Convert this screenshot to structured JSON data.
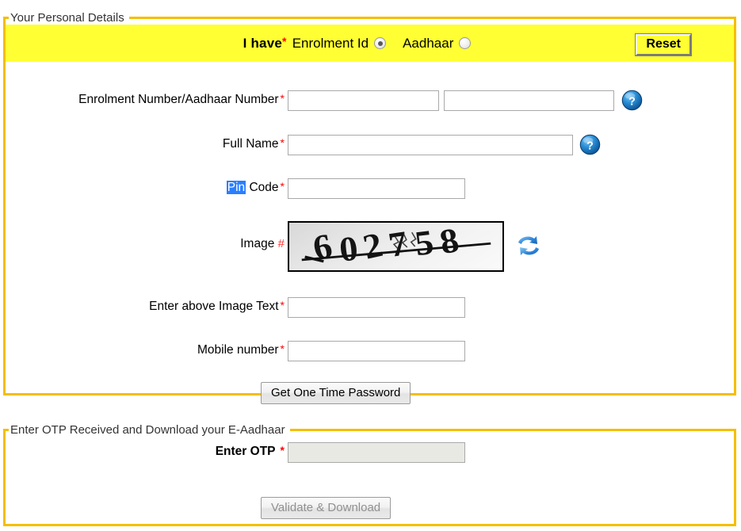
{
  "personal_panel": {
    "legend": "Your Personal Details",
    "ihave": {
      "label": "I have",
      "required_mark": "*",
      "option_enrolment": "Enrolment Id",
      "option_aadhaar": "Aadhaar",
      "selected": "Enrolment Id"
    },
    "reset_button": "Reset",
    "fields": [
      {
        "label": "Enrolment Number/Aadhaar Number",
        "required_mark": "*",
        "value": "",
        "second_value": "",
        "help_icon": "help-question-icon"
      },
      {
        "label": "Full Name",
        "required_mark": "*",
        "value": "",
        "help_icon": "help-question-icon"
      },
      {
        "label_highlighted": "Pin",
        "label_rest": " Code",
        "required_mark": "*",
        "value": ""
      },
      {
        "label": "Image",
        "required_mark": "#",
        "captcha_text": "602758",
        "refresh_icon": "refresh-arrows-icon"
      },
      {
        "label": "Enter above Image Text",
        "required_mark": "*",
        "value": ""
      },
      {
        "label": "Mobile number",
        "required_mark": "*",
        "value": ""
      }
    ],
    "submit_button": "Get One Time Password"
  },
  "otp_panel": {
    "legend": "Enter OTP Received and Download your E-Aadhaar",
    "otp_label": "Enter OTP",
    "otp_required_mark": "*",
    "otp_value": "",
    "validate_button": "Validate & Download"
  },
  "colors": {
    "panel_border": "#F5BE00",
    "highlight_bar": "#FFFF33",
    "required_star": "#FF0000",
    "selection_blue": "#2A7FFF",
    "help_icon_blue": "#1C7FD4",
    "refresh_icon_blue": "#2E86DE"
  }
}
